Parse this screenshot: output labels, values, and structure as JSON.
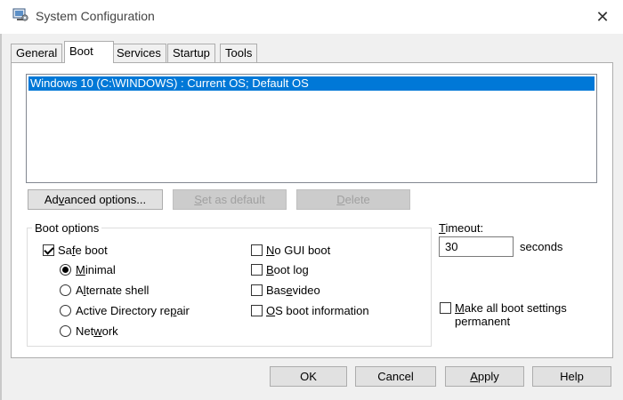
{
  "window": {
    "title": "System Configuration",
    "close_glyph": "✕"
  },
  "tabs": [
    {
      "label": "General"
    },
    {
      "label": "Boot"
    },
    {
      "label": "Services"
    },
    {
      "label": "Startup"
    },
    {
      "label": "Tools"
    }
  ],
  "active_tab": "Boot",
  "os_list": [
    {
      "label": "Windows 10 (C:\\WINDOWS) : Current OS; Default OS",
      "selected": true
    }
  ],
  "list_buttons": {
    "advanced": {
      "pre": "Ad",
      "key": "v",
      "post": "anced options..."
    },
    "set_default": {
      "pre": "",
      "key": "S",
      "post": "et as default"
    },
    "delete": {
      "pre": "",
      "key": "D",
      "post": "elete"
    }
  },
  "boot_options": {
    "label": "Boot options",
    "safe_boot": {
      "pre": "Sa",
      "key": "f",
      "post": "e boot",
      "checked": true
    },
    "minimal": {
      "pre": "",
      "key": "M",
      "post": "inimal",
      "checked": true
    },
    "alternate_shell": {
      "pre": "A",
      "key": "l",
      "post": "ternate shell",
      "checked": false
    },
    "ad_repair": {
      "pre": "Active Directory re",
      "key": "p",
      "post": "air",
      "checked": false
    },
    "network": {
      "pre": "Net",
      "key": "w",
      "post": "ork",
      "checked": false
    },
    "no_gui_boot": {
      "pre": "",
      "key": "N",
      "post": "o GUI boot",
      "checked": false
    },
    "boot_log": {
      "pre": "",
      "key": "B",
      "post": "oot log",
      "checked": false
    },
    "base_video": {
      "pre": "Bas",
      "key": "e",
      "post": " video",
      "checked": false
    },
    "os_boot_info": {
      "pre": "",
      "key": "O",
      "post": "S boot information",
      "checked": false
    }
  },
  "timeout": {
    "pre": "",
    "key": "T",
    "post": "imeout:",
    "value": "30",
    "unit": "seconds"
  },
  "make_permanent": {
    "pre": "",
    "key": "M",
    "post": "ake all boot settings permanent",
    "checked": false
  },
  "footer": {
    "ok": "OK",
    "cancel": "Cancel",
    "apply": {
      "pre": "",
      "key": "A",
      "post": "pply"
    },
    "help": "Help"
  },
  "colors": {
    "selection": "#0078d7",
    "window_bg": "#f0f0f0",
    "panel_bg": "#ffffff"
  }
}
